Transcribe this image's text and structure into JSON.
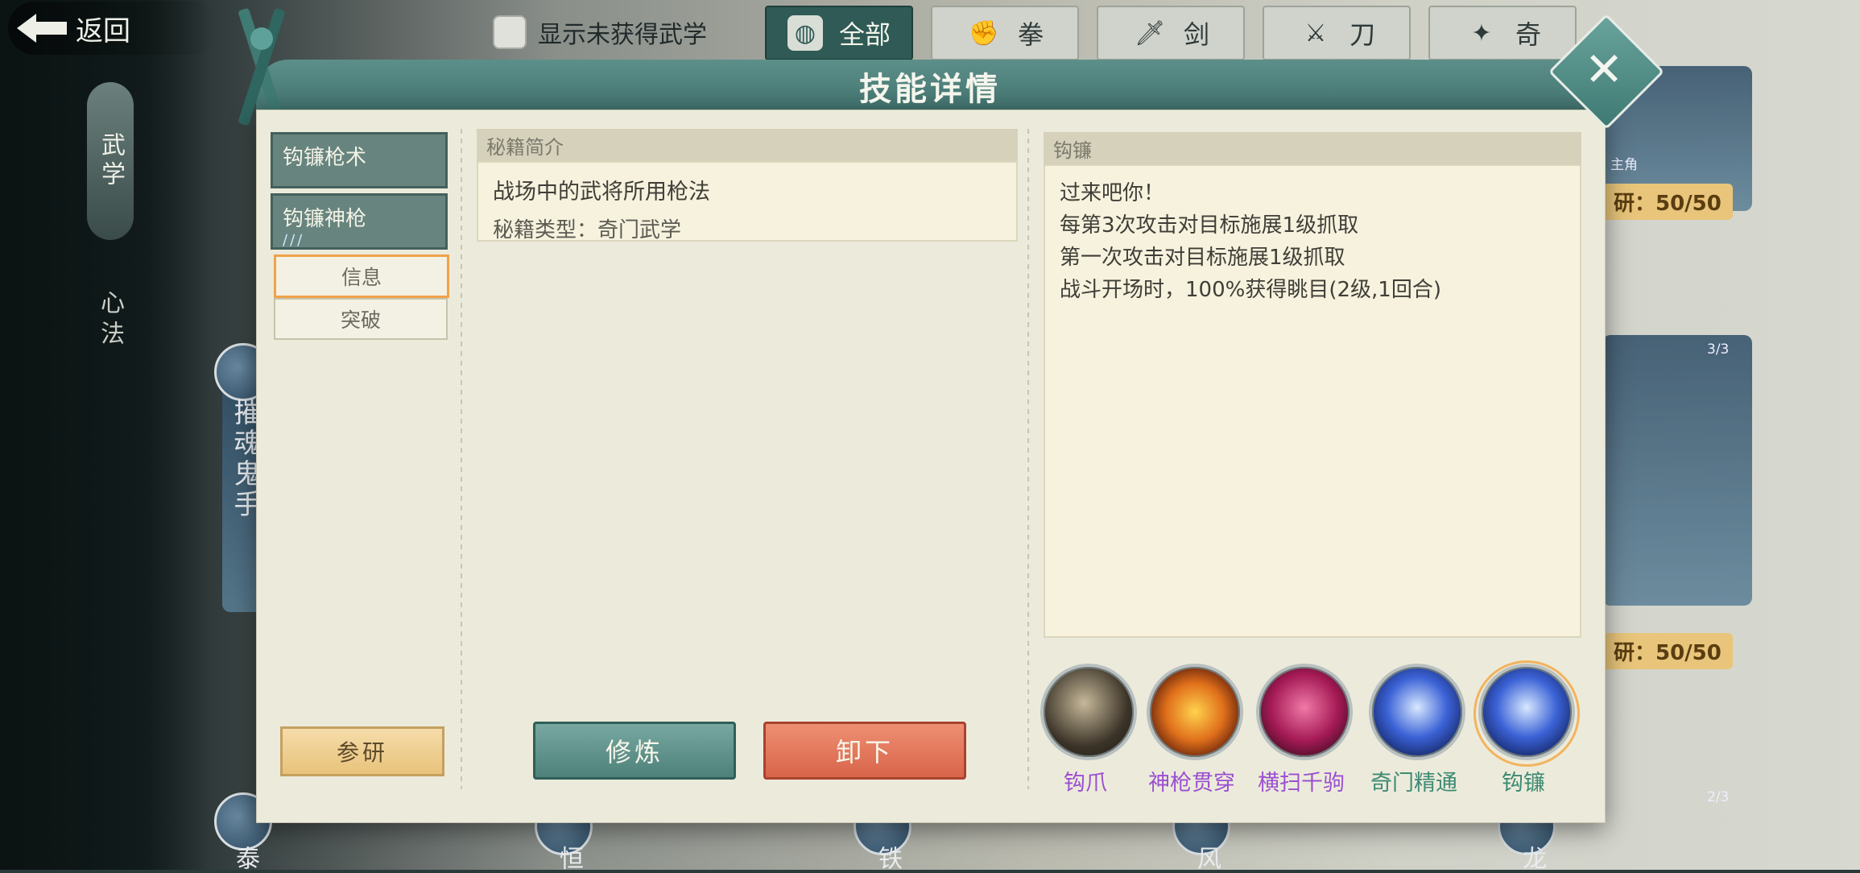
{
  "top_bar": {
    "back_label": "返回",
    "show_unobtained_label": "显示未获得武学",
    "tabs": [
      {
        "label": "全部",
        "icon": "pouch-icon",
        "active": true
      },
      {
        "label": "拳",
        "icon": "fist-icon",
        "active": false
      },
      {
        "label": "剑",
        "icon": "sword-icon",
        "active": false
      },
      {
        "label": "刀",
        "icon": "blade-icon",
        "active": false
      },
      {
        "label": "奇",
        "icon": "shuriken-icon",
        "active": false
      }
    ]
  },
  "left_menu": {
    "active": "武学",
    "inactive": "心法"
  },
  "background": {
    "card_vertical_title": "摧魂鬼手",
    "research_badge_1": "研：50/50",
    "research_badge_2": "研：50/50",
    "count_1": "3/3",
    "count_2": "2/3",
    "hero_label": "主角",
    "bottom_chars": [
      "泰",
      "恒",
      "铁",
      "风",
      "龙"
    ]
  },
  "modal": {
    "title": "技能详情",
    "skill_list": [
      {
        "name": "钩镰枪术",
        "sub": ""
      },
      {
        "name": "钩镰神枪",
        "sub": "∕∕∕"
      }
    ],
    "side_buttons": {
      "info": "信息",
      "breakthrough": "突破"
    },
    "research_button": "参研",
    "intro_panel": {
      "header": "秘籍简介",
      "description": "战场中的武将所用枪法",
      "type_line": "秘籍类型：奇门武学"
    },
    "detail_panel": {
      "header": "钩镰",
      "lines": [
        "过来吧你！",
        "",
        "每第3次攻击对目标施展1级抓取",
        "第一次攻击对目标施展1级抓取",
        "战斗开场时，100%获得眺目(2级,1回合)"
      ]
    },
    "actions": {
      "train": "修炼",
      "unload": "卸下"
    },
    "skill_icons": [
      {
        "label": "钩爪",
        "color_class": "purple",
        "icon": "hook-claw-icon"
      },
      {
        "label": "神枪贯穿",
        "color_class": "purple",
        "icon": "spear-pierce-icon"
      },
      {
        "label": "横扫千驹",
        "color_class": "purple",
        "icon": "sweep-icon"
      },
      {
        "label": "奇门精通",
        "color_class": "green",
        "icon": "mastery-icon"
      },
      {
        "label": "钩镰",
        "color_class": "green",
        "icon": "hook-sickle-icon",
        "selected": true
      }
    ]
  }
}
